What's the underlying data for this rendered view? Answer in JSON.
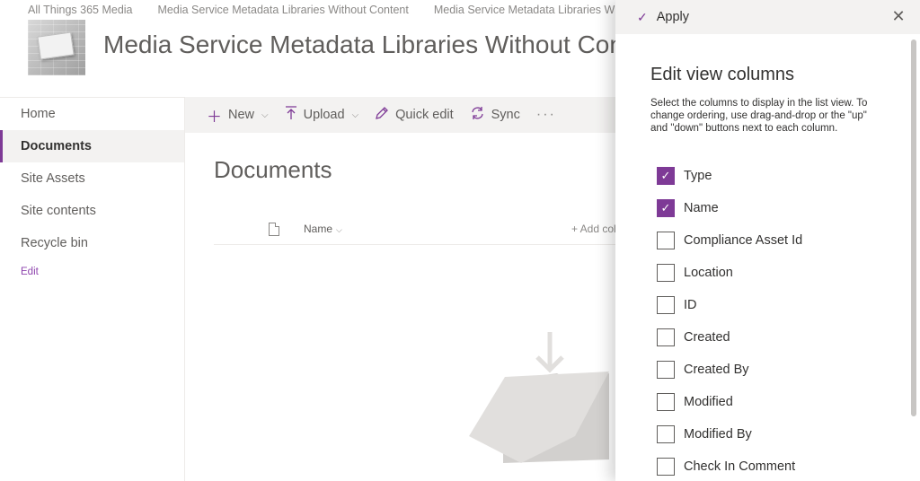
{
  "site_tabs": [
    "All Things 365 Media",
    "Media Service Metadata Libraries Without Content",
    "Media Service Metadata Libraries Without Content"
  ],
  "header": {
    "site_title": "Media Service Metadata Libraries Without Content"
  },
  "left_nav": {
    "items": [
      {
        "label": "Home",
        "active": false
      },
      {
        "label": "Documents",
        "active": true
      },
      {
        "label": "Site Assets",
        "active": false
      },
      {
        "label": "Site contents",
        "active": false
      },
      {
        "label": "Recycle bin",
        "active": false
      }
    ],
    "edit_label": "Edit"
  },
  "command_bar": {
    "new_label": "New",
    "upload_label": "Upload",
    "quick_edit_label": "Quick edit",
    "sync_label": "Sync",
    "more_label": "···"
  },
  "main": {
    "title": "Documents",
    "list_header": {
      "name_label": "Name",
      "add_column_label": "+ Add column"
    }
  },
  "panel": {
    "apply_label": "Apply",
    "title": "Edit view columns",
    "description": "Select the columns to display in the list view. To change ordering, use drag-and-drop or the \"up\" and \"down\" buttons next to each column.",
    "columns": [
      {
        "label": "Type",
        "checked": true
      },
      {
        "label": "Name",
        "checked": true
      },
      {
        "label": "Compliance Asset Id",
        "checked": false
      },
      {
        "label": "Location",
        "checked": false
      },
      {
        "label": "ID",
        "checked": false
      },
      {
        "label": "Created",
        "checked": false
      },
      {
        "label": "Created By",
        "checked": false
      },
      {
        "label": "Modified",
        "checked": false
      },
      {
        "label": "Modified By",
        "checked": false
      },
      {
        "label": "Check In Comment",
        "checked": false
      }
    ]
  },
  "colors": {
    "accent": "#7e3a96",
    "nav_active_bg": "#f3f2f1",
    "command_bar_bg": "#f3f2f1"
  },
  "icons": {
    "apply": "checkmark-icon",
    "close": "close-icon",
    "new": "plus-icon",
    "upload": "upload-arrow-icon",
    "quick_edit": "pencil-icon",
    "sync": "sync-icon",
    "file_type": "document-icon"
  }
}
